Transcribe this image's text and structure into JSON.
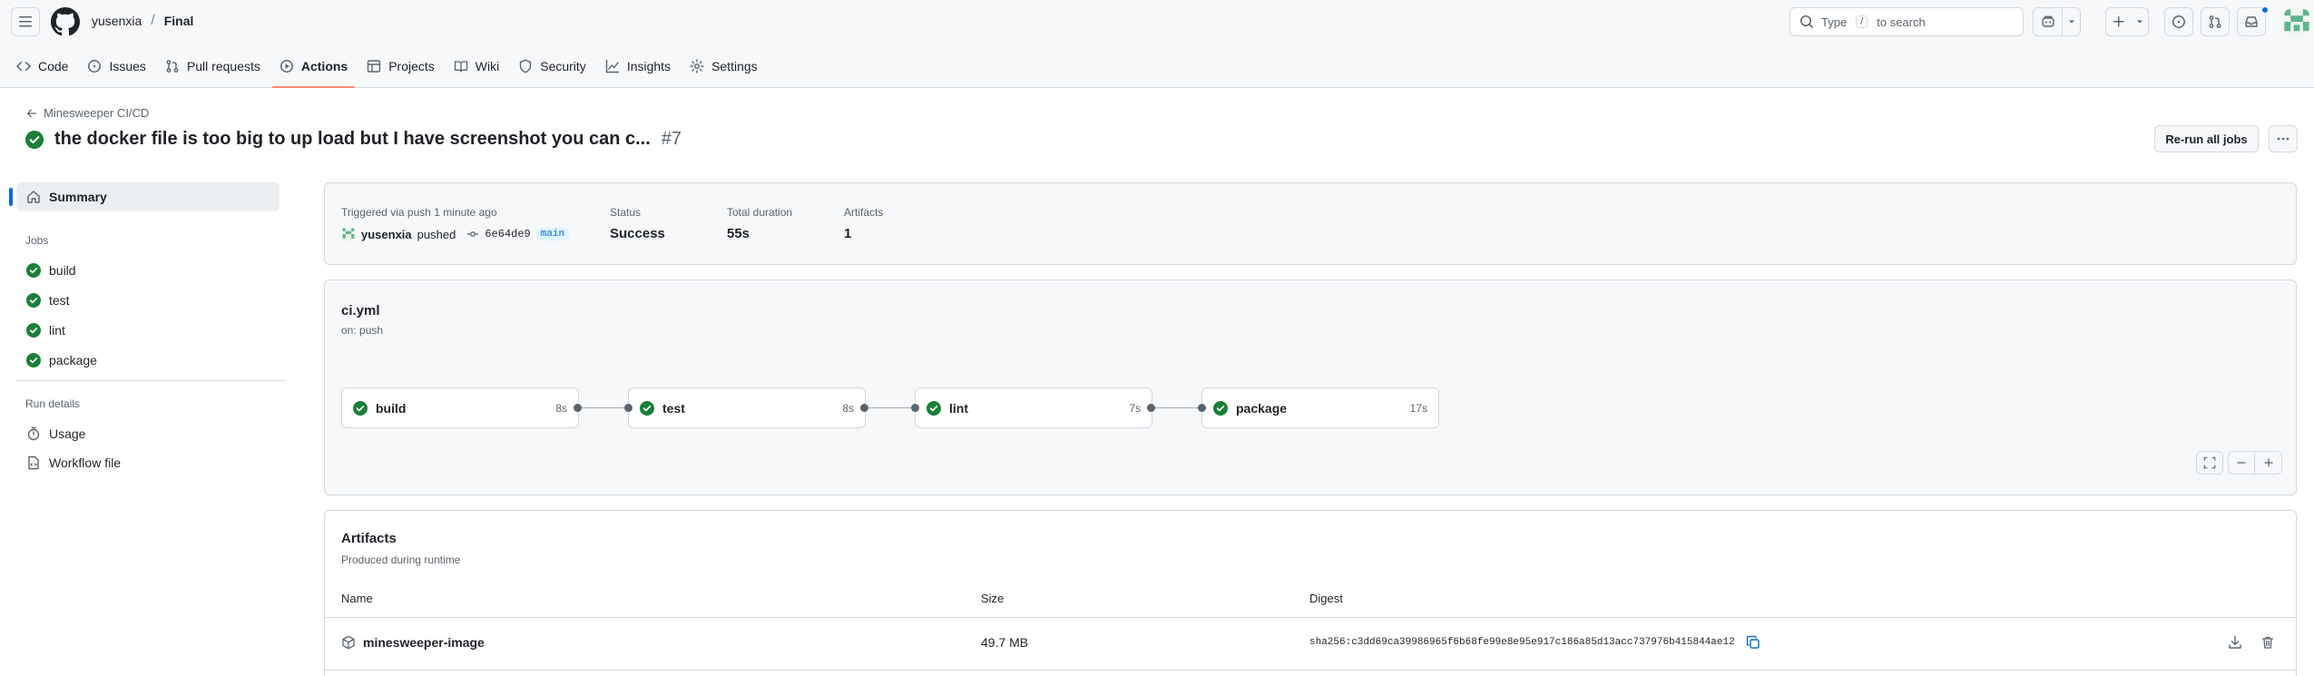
{
  "header": {
    "owner": "yusenxia",
    "separator": "/",
    "repo": "Final",
    "search_prefix": "Type",
    "search_key": "/",
    "search_suffix": "to search"
  },
  "nav": {
    "tabs": [
      {
        "label": "Code",
        "icon": "code-icon"
      },
      {
        "label": "Issues",
        "icon": "issue-icon"
      },
      {
        "label": "Pull requests",
        "icon": "pull-request-icon"
      },
      {
        "label": "Actions",
        "icon": "play-icon",
        "selected": true
      },
      {
        "label": "Projects",
        "icon": "table-icon"
      },
      {
        "label": "Wiki",
        "icon": "book-icon"
      },
      {
        "label": "Security",
        "icon": "shield-icon"
      },
      {
        "label": "Insights",
        "icon": "graph-icon"
      },
      {
        "label": "Settings",
        "icon": "gear-icon"
      }
    ]
  },
  "run": {
    "back_label": "Minesweeper CI/CD",
    "title": "the docker file is too big to up load but I have screenshot you can c...",
    "number": "#7",
    "rerun_label": "Re-run all jobs"
  },
  "sidebar": {
    "summary_label": "Summary",
    "jobs_heading": "Jobs",
    "jobs": [
      "build",
      "test",
      "lint",
      "package"
    ],
    "run_details_heading": "Run details",
    "usage_label": "Usage",
    "workflow_file_label": "Workflow file"
  },
  "summary": {
    "trigger_label": "Triggered via push 1 minute ago",
    "actor": "yusenxia",
    "action": "pushed",
    "commit": "6e64de9",
    "branch": "main",
    "status_label": "Status",
    "status_value": "Success",
    "duration_label": "Total duration",
    "duration_value": "55s",
    "artifacts_label": "Artifacts",
    "artifacts_value": "1"
  },
  "workflow": {
    "file": "ci.yml",
    "trigger": "on: push",
    "jobs": [
      {
        "name": "build",
        "duration": "8s"
      },
      {
        "name": "test",
        "duration": "8s"
      },
      {
        "name": "lint",
        "duration": "7s"
      },
      {
        "name": "package",
        "duration": "17s"
      }
    ]
  },
  "artifacts": {
    "title": "Artifacts",
    "subtitle": "Produced during runtime",
    "columns": [
      "Name",
      "Size",
      "Digest"
    ],
    "rows": [
      {
        "name": "minesweeper-image",
        "size": "49.7 MB",
        "digest": "sha256:c3dd69ca39986965f6b68fe99e8e95e917c186a85d13acc737976b415844ae12"
      }
    ]
  },
  "colors": {
    "success": "#1a7f37",
    "accent": "#0969da",
    "selected_tab_underline": "#fd8c73"
  }
}
